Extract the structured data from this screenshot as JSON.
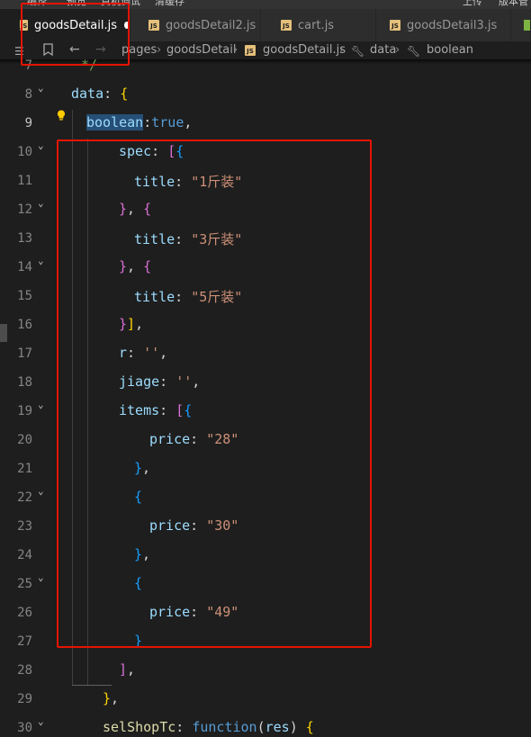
{
  "menu": [
    "编译",
    "预览",
    "真机调试",
    "清缓存",
    "上传",
    "版本管"
  ],
  "tabs": [
    {
      "label": "goodsDetail.js",
      "active": true,
      "modified": true,
      "icon": "js-file-icon"
    },
    {
      "label": "goodsDetail2.js",
      "active": false,
      "icon": "js-file-icon"
    },
    {
      "label": "cart.js",
      "active": false,
      "icon": "js-file-icon"
    },
    {
      "label": "goodsDetail3.js",
      "active": false,
      "icon": "js-file-icon"
    }
  ],
  "breadcrumb": {
    "path": [
      "pages",
      "goodsDetail",
      "goodsDetail.js",
      "data",
      "boolean"
    ],
    "icons": [
      "list-icon",
      "bookmark-icon",
      "back-arrow-icon",
      "forward-arrow-icon",
      "js-file-icon",
      "wrench-icon",
      "wrench-icon"
    ]
  },
  "lines": [
    {
      "n": "7",
      "text": "*/"
    },
    {
      "n": "8",
      "text": "data: {"
    },
    {
      "n": "9",
      "text": "boolean:true,"
    },
    {
      "n": "10",
      "text": "spec: [{"
    },
    {
      "n": "11",
      "text": "title: \"1斤装\""
    },
    {
      "n": "12",
      "text": "}, {"
    },
    {
      "n": "13",
      "text": "title: \"3斤装\""
    },
    {
      "n": "14",
      "text": "}, {"
    },
    {
      "n": "15",
      "text": "title: \"5斤装\""
    },
    {
      "n": "16",
      "text": "}],"
    },
    {
      "n": "17",
      "text": "r: '',"
    },
    {
      "n": "18",
      "text": "jiage: '',"
    },
    {
      "n": "19",
      "text": "items: [{"
    },
    {
      "n": "20",
      "text": "price: \"28\""
    },
    {
      "n": "21",
      "text": "},"
    },
    {
      "n": "22",
      "text": "{"
    },
    {
      "n": "23",
      "text": "price: \"30\""
    },
    {
      "n": "24",
      "text": "},"
    },
    {
      "n": "25",
      "text": "{"
    },
    {
      "n": "26",
      "text": "price: \"49\""
    },
    {
      "n": "27",
      "text": "}"
    },
    {
      "n": "28",
      "text": "],"
    },
    {
      "n": "29",
      "text": "},"
    },
    {
      "n": "30",
      "text": "selShopTc: function(res) {"
    }
  ],
  "colors": {
    "highlight_box": "#e51400",
    "keyword": "#569cd6",
    "string": "#ce9178",
    "property": "#9cdcfe",
    "bracket_gold": "#ffd700",
    "bracket_purple": "#da70d6",
    "bracket_blue": "#179fff"
  }
}
